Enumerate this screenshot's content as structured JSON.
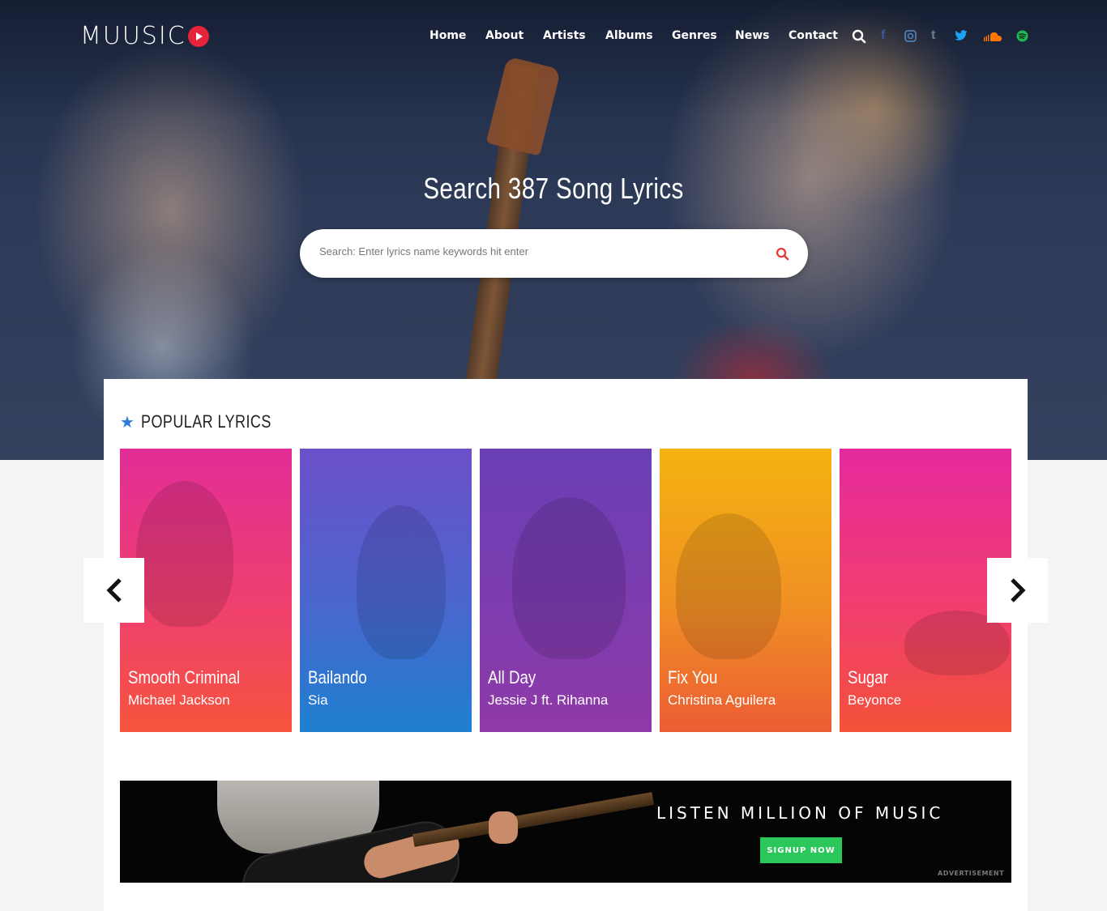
{
  "brand": {
    "name": "MUUSIC"
  },
  "nav": {
    "items": [
      "Home",
      "About",
      "Artists",
      "Albums",
      "Genres",
      "News",
      "Contact"
    ]
  },
  "social_icons": [
    "search-icon",
    "facebook-icon",
    "instagram-icon",
    "tumblr-icon",
    "twitter-icon",
    "soundcloud-icon",
    "spotify-icon"
  ],
  "hero": {
    "title": "Search 387 Song Lyrics",
    "search_placeholder": "Search: Enter lyrics name keywords hit enter"
  },
  "popular": {
    "heading": "POPULAR LYRICS",
    "cards": [
      {
        "title": "Smooth Criminal",
        "artist": "Michael Jackson"
      },
      {
        "title": "Bailando",
        "artist": "Sia"
      },
      {
        "title": "All Day",
        "artist": "Jessie J ft. Rihanna"
      },
      {
        "title": "Fix You",
        "artist": "Christina Aguilera"
      },
      {
        "title": "Sugar",
        "artist": "Beyonce"
      }
    ]
  },
  "banner": {
    "headline": "LISTEN MILLION OF MUSIC",
    "cta": "SIGNUP NOW",
    "label": "ADVERTISEMENT"
  },
  "colors": {
    "accent_red": "#e5233b",
    "star_blue": "#2e7bd6",
    "cta_green": "#2bc75a",
    "facebook": "#3b5998",
    "instagram": "#4f7fb3",
    "tumblr": "#6b7f96",
    "twitter": "#1da1f2",
    "soundcloud": "#ff7700",
    "spotify": "#1db954"
  }
}
